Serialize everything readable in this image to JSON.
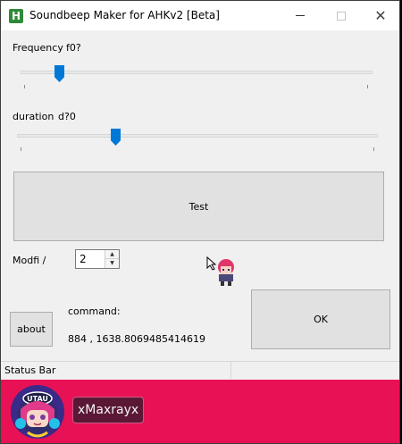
{
  "window": {
    "title": "Soundbeep Maker for AHKv2 [Beta]",
    "app_icon_letter": "H",
    "close_glyph": "✕"
  },
  "frequency": {
    "label": "Frequency",
    "value_label": "f0?",
    "slider_value_fraction": 0.1
  },
  "duration": {
    "label": "duration",
    "value_label": "d?0",
    "slider_value_fraction": 0.27
  },
  "buttons": {
    "test": "Test",
    "about": "about",
    "ok": "OK"
  },
  "modifier": {
    "label": "Modfi /",
    "value": "2",
    "up_glyph": "▲",
    "down_glyph": "▼"
  },
  "command": {
    "label": "command:",
    "value": "884 , 1638.8069485414619"
  },
  "status_bar": {
    "text": "Status Bar"
  },
  "banner": {
    "username": "xMaxrayx",
    "avatar_text": "UTAU",
    "color": "#e81155"
  }
}
